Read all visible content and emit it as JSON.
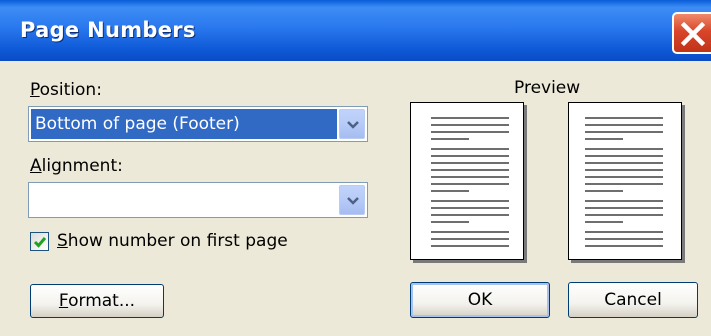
{
  "dialog": {
    "title": "Page Numbers"
  },
  "position": {
    "label_accel": "P",
    "label_rest": "osition:",
    "value": "Bottom of page (Footer)"
  },
  "alignment": {
    "label_accel": "A",
    "label_rest": "lignment:",
    "value": ""
  },
  "first_page": {
    "checked": true,
    "label_accel": "S",
    "label_rest": "how number on first page"
  },
  "preview": {
    "label": "Preview"
  },
  "buttons": {
    "format_accel": "F",
    "format_rest": "ormat...",
    "ok": "OK",
    "cancel": "Cancel"
  },
  "icons": {
    "close": "close-icon",
    "dropdown": "chevron-down-icon",
    "check": "checkmark-icon"
  },
  "colors": {
    "titlebar": "#2a78ee",
    "close": "#d9452a",
    "selection": "#316ac5",
    "dialog_bg": "#ece9d8"
  }
}
